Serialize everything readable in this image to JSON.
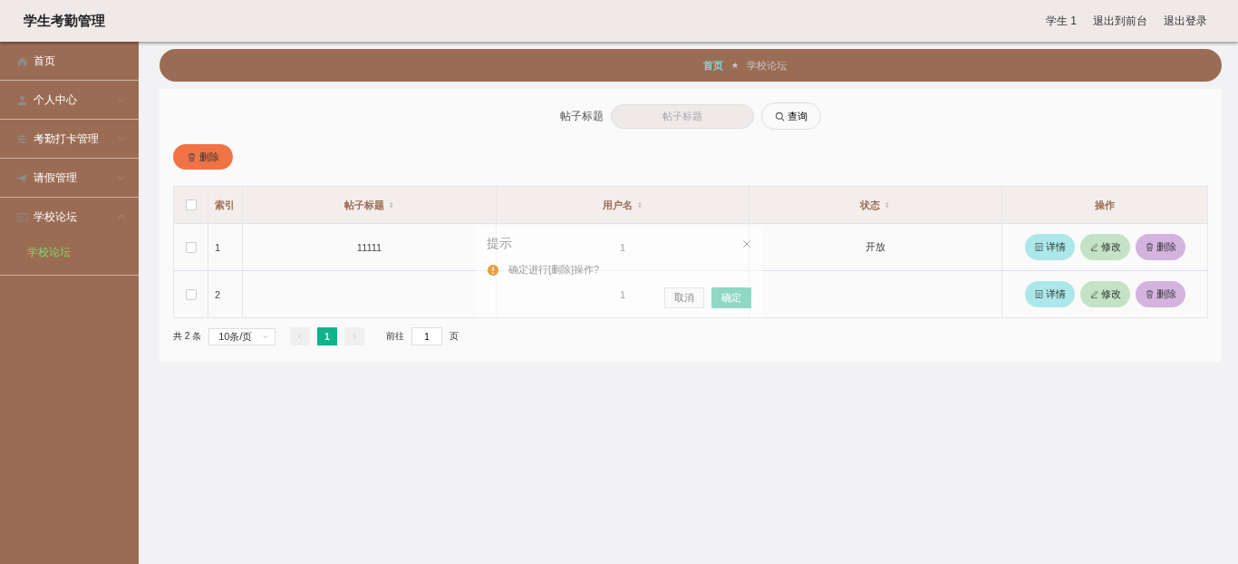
{
  "header": {
    "title": "学生考勤管理",
    "links": [
      "学生 1",
      "退出到前台",
      "退出登录"
    ]
  },
  "sidebar": {
    "items": [
      {
        "label": "首页"
      },
      {
        "label": "个人中心",
        "expanded": false
      },
      {
        "label": "考勤打卡管理",
        "expanded": false
      },
      {
        "label": "请假管理",
        "expanded": false
      },
      {
        "label": "学校论坛",
        "expanded": true,
        "children": [
          {
            "label": "学校论坛",
            "selected": true
          }
        ]
      }
    ]
  },
  "breadcrumb": [
    {
      "label": "首页",
      "current": false
    },
    {
      "label": "学校论坛",
      "current": true
    }
  ],
  "search": {
    "label": "帖子标题",
    "placeholder": "帖子标题",
    "button": "查询"
  },
  "delete_button": "删除",
  "table": {
    "all_checked": false,
    "columns": [
      {
        "label": "索引",
        "sortable": false
      },
      {
        "label": "帖子标题",
        "sortable": true
      },
      {
        "label": "用户名",
        "sortable": true
      },
      {
        "label": "状态",
        "sortable": true
      },
      {
        "label": "操作",
        "sortable": false
      }
    ],
    "rows": [
      {
        "checked": false,
        "cells": [
          "1",
          "11111",
          "1",
          "开放"
        ],
        "actions": [
          {
            "kind": "detail",
            "label": "详情"
          },
          {
            "kind": "edit",
            "label": "修改"
          },
          {
            "kind": "delete",
            "label": "删除"
          }
        ]
      },
      {
        "checked": false,
        "cells": [
          "2",
          "",
          "1",
          ""
        ],
        "actions": [
          {
            "kind": "detail",
            "label": "详情"
          },
          {
            "kind": "edit",
            "label": "修改"
          },
          {
            "kind": "delete",
            "label": "删除"
          }
        ]
      }
    ]
  },
  "pagination": {
    "total": "共 2 条",
    "page_size": "10条/页",
    "pages": [
      {
        "label": "1",
        "selected": true
      }
    ],
    "goto_label": "前往",
    "goto_value": "1",
    "goto_suffix": "页"
  },
  "dialog": {
    "title": "提示",
    "message": "确定进行[删除]操作?",
    "buttons": [
      {
        "kind": "cancel",
        "label": "取消"
      },
      {
        "kind": "confirm",
        "label": "确定"
      }
    ]
  }
}
